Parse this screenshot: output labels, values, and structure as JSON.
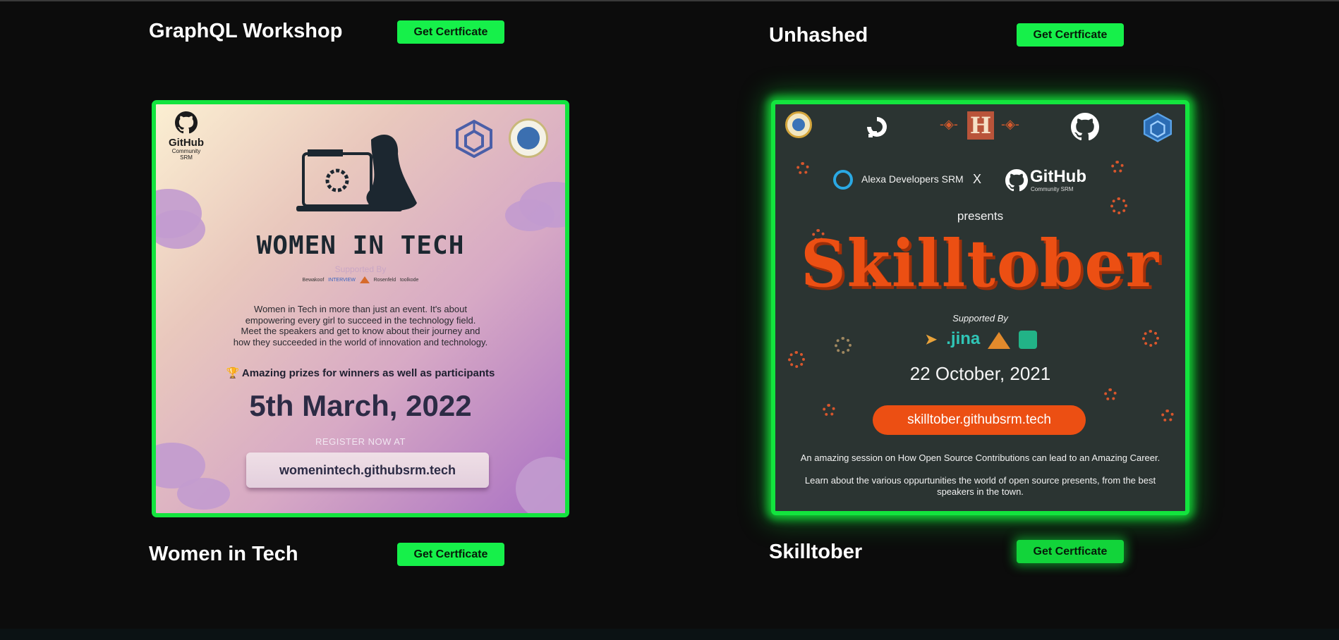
{
  "events": [
    {
      "title": "GraphQL Workshop",
      "button": "Get Certficate"
    },
    {
      "title": "Unhashed",
      "button": "Get Certficate"
    },
    {
      "title": "Women in Tech",
      "button": "Get Certficate"
    },
    {
      "title": "Skilltober",
      "button": "Get Certficate"
    }
  ],
  "colors": {
    "accent": "#16f04a",
    "background": "#0c0c0c",
    "skilltober_orange": "#ec4f13",
    "women_text": "#2c2b45"
  },
  "women_poster": {
    "logo_top": "GitHub",
    "logo_sub1": "Community",
    "logo_sub2": "SRM",
    "heading": "WOMEN IN TECH",
    "supported_by": "Supported By",
    "sponsors": [
      "Bewakoof",
      "INTERVIEW",
      "Rosenfeld",
      "toolkode"
    ],
    "description": [
      "Women in Tech in more than just an event. It's about",
      "empowering every girl to succeed in the technology field.",
      "Meet the speakers and get to know about their journey and",
      "how they succeeded in the world of innovation and technology."
    ],
    "prize_icon": "trophy-icon",
    "prizes": "Amazing prizes for winners as well as participants",
    "date": "5th March, 2022",
    "register": "REGISTER NOW AT",
    "url": "womenintech.githubsrm.tech"
  },
  "skilltober_poster": {
    "partner_left": "Alexa Developers SRM",
    "cross": "X",
    "partner_right": "GitHub",
    "partner_right_sub": "Community SRM",
    "presents": "presents",
    "title": "Skilltober",
    "supported_by": "Supported By",
    "date": "22 October, 2021",
    "url": "skilltober.githubsrm.tech",
    "line1": "An amazing session on How Open Source Contributions can lead to an Amazing Career.",
    "line2a": "Learn about the various oppurtunities the world of open source presents, from the best",
    "line2b": "speakers in the town."
  }
}
